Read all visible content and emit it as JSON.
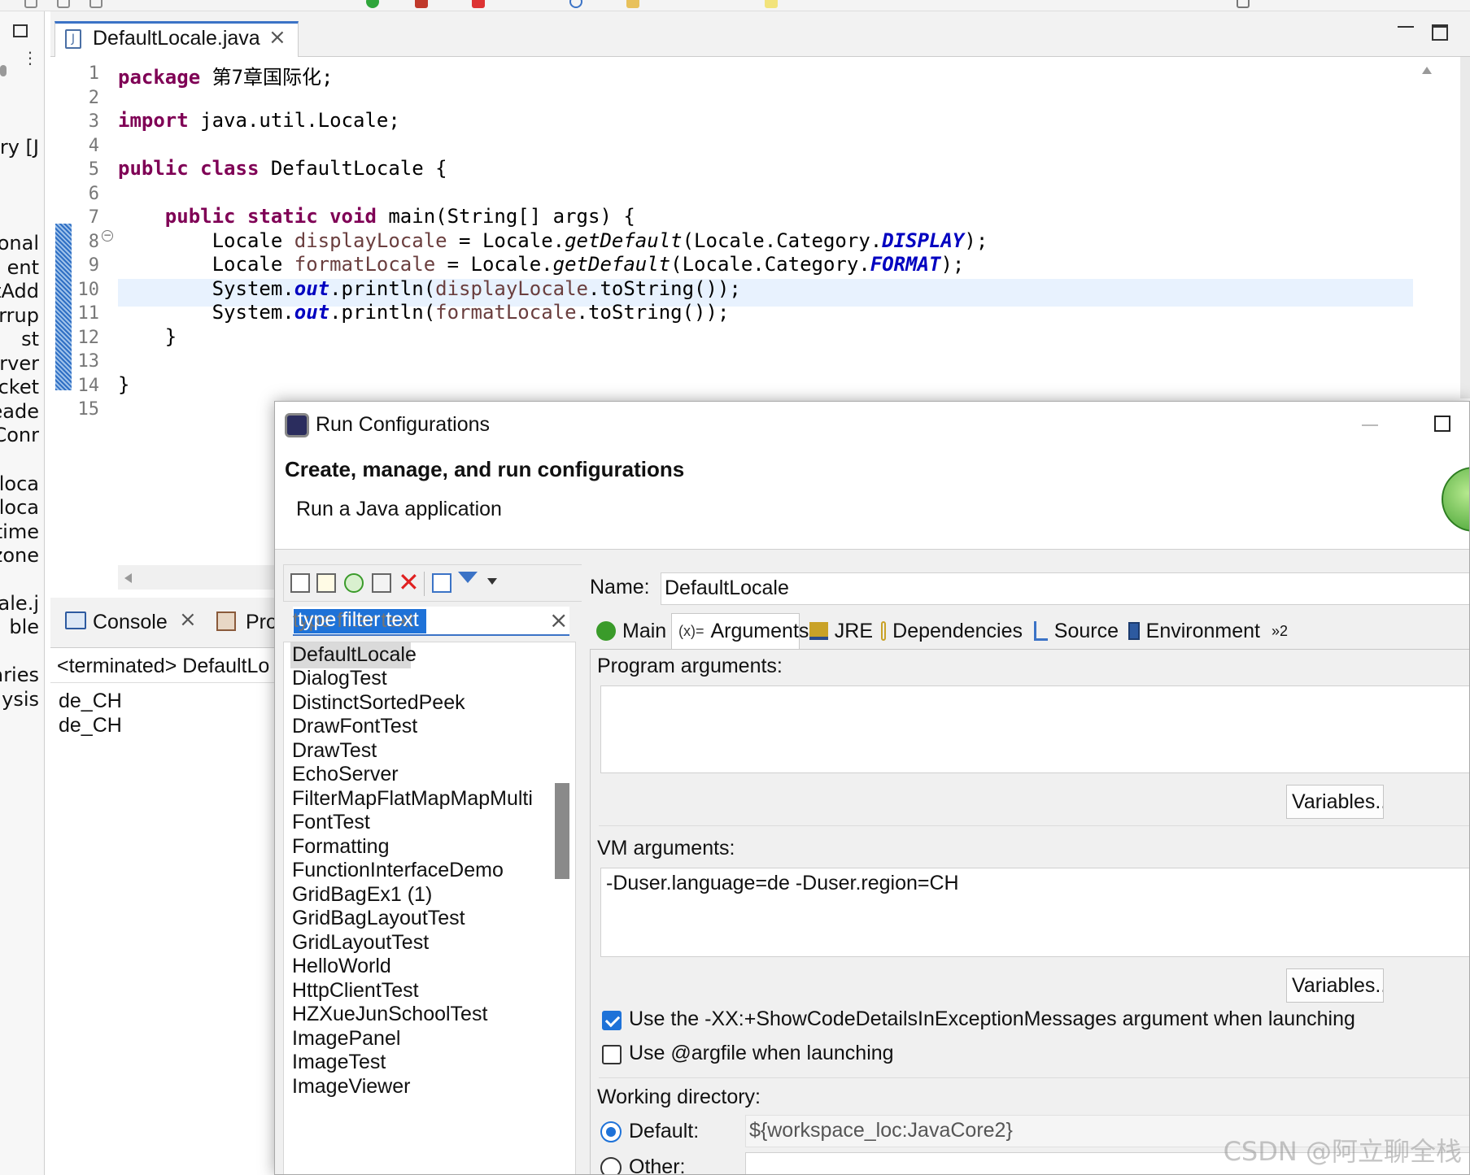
{
  "editor": {
    "tab_title": "DefaultLocale.java",
    "lines": [
      {
        "n": "1",
        "segments": [
          [
            "kw",
            "package"
          ],
          [
            "",
            " 第7章国际化;"
          ]
        ]
      },
      {
        "n": "2",
        "segments": []
      },
      {
        "n": "3",
        "segments": [
          [
            "kw",
            "import"
          ],
          [
            "",
            " java.util.Locale;"
          ]
        ]
      },
      {
        "n": "4",
        "segments": []
      },
      {
        "n": "5",
        "segments": [
          [
            "kw",
            "public"
          ],
          [
            "",
            " "
          ],
          [
            "kw",
            "class"
          ],
          [
            "",
            " DefaultLocale {"
          ]
        ]
      },
      {
        "n": "6",
        "segments": []
      },
      {
        "n": "7",
        "segments": [
          [
            "",
            "    "
          ],
          [
            "kw",
            "public"
          ],
          [
            "",
            " "
          ],
          [
            "kw",
            "static"
          ],
          [
            "",
            " "
          ],
          [
            "kw",
            "void"
          ],
          [
            "",
            " main(String[] args) {"
          ]
        ]
      },
      {
        "n": "8",
        "segments": [
          [
            "",
            "        Locale "
          ],
          [
            "var",
            "displayLocale"
          ],
          [
            "",
            " = Locale."
          ],
          [
            "mth",
            "getDefault"
          ],
          [
            "",
            "(Locale.Category."
          ],
          [
            "fld",
            "DISPLAY"
          ],
          [
            "",
            ");"
          ]
        ]
      },
      {
        "n": "9",
        "segments": [
          [
            "",
            "        Locale "
          ],
          [
            "var",
            "formatLocale"
          ],
          [
            "",
            " = Locale."
          ],
          [
            "mth",
            "getDefault"
          ],
          [
            "",
            "(Locale.Category."
          ],
          [
            "fld",
            "FORMAT"
          ],
          [
            "",
            ");"
          ]
        ]
      },
      {
        "n": "10",
        "segments": [
          [
            "",
            "        System."
          ],
          [
            "fld",
            "out"
          ],
          [
            "",
            ".println("
          ],
          [
            "var",
            "displayLocale"
          ],
          [
            "",
            ".toString());"
          ]
        ]
      },
      {
        "n": "11",
        "segments": [
          [
            "",
            "        System."
          ],
          [
            "fld",
            "out"
          ],
          [
            "",
            ".println("
          ],
          [
            "var",
            "formatLocale"
          ],
          [
            "",
            ".toString());"
          ]
        ]
      },
      {
        "n": "12",
        "segments": [
          [
            "",
            "    }"
          ]
        ]
      },
      {
        "n": "13",
        "segments": []
      },
      {
        "n": "14",
        "segments": [
          [
            "",
            "}"
          ]
        ]
      },
      {
        "n": "15",
        "segments": []
      }
    ]
  },
  "left_panel": {
    "items": [
      "ary [J",
      "onal",
      "ent",
      "etAdd",
      "errup",
      "st",
      "rver",
      "cket",
      "reade",
      "Conr",
      ".loca",
      ".loca",
      ".time",
      ".zone",
      "cale.j",
      "ble",
      "aries",
      "lysis"
    ]
  },
  "console": {
    "tab_label": "Console",
    "second_tab_label": "Pro",
    "terminated_line": "<terminated> DefaultLo",
    "output": [
      "de_CH",
      "de_CH"
    ]
  },
  "dialog": {
    "title": "Run Configurations",
    "header_title": "Create, manage, and run configurations",
    "header_subtitle": "Run a Java application",
    "filter_placeholder": "type filter text",
    "filter_value": "type filter text",
    "configs": [
      "DefaultLocale",
      "DialogTest",
      "DistinctSortedPeek",
      "DrawFontTest",
      "DrawTest",
      "EchoServer",
      "FilterMapFlatMapMapMulti",
      "FontTest",
      "Formatting",
      "FunctionInterfaceDemo",
      "GridBagEx1 (1)",
      "GridBagLayoutTest",
      "GridLayoutTest",
      "HelloWorld",
      "HttpClientTest",
      "HZXueJunSchoolTest",
      "ImagePanel",
      "ImageTest",
      "ImageViewer"
    ],
    "selected_config": "DefaultLocale",
    "name_label": "Name:",
    "name_value": "DefaultLocale",
    "tabs": [
      "Main",
      "Arguments",
      "JRE",
      "Dependencies",
      "Source",
      "Environment"
    ],
    "tab_overflow": "»2",
    "active_tab": "Arguments",
    "program_args_label": "Program arguments:",
    "program_args_value": "",
    "vm_args_label": "VM arguments:",
    "vm_args_value": "-Duser.language=de -Duser.region=CH",
    "variables_label": "Variables...",
    "show_code_details_label": "Use the -XX:+ShowCodeDetailsInExceptionMessages argument when launching",
    "show_code_details_checked": true,
    "argfile_label": "Use @argfile when launching",
    "argfile_checked": false,
    "working_dir_label": "Working directory:",
    "default_label": "Default:",
    "default_value": "${workspace_loc:JavaCore2}",
    "other_label": "Other:"
  },
  "watermark": "CSDN @阿立聊全栈",
  "colors": {
    "keyword": "#7f0055",
    "field": "#0000c0",
    "variable": "#6a3e3e",
    "accent": "#1e72d8",
    "current_line": "#e8f2fe"
  }
}
